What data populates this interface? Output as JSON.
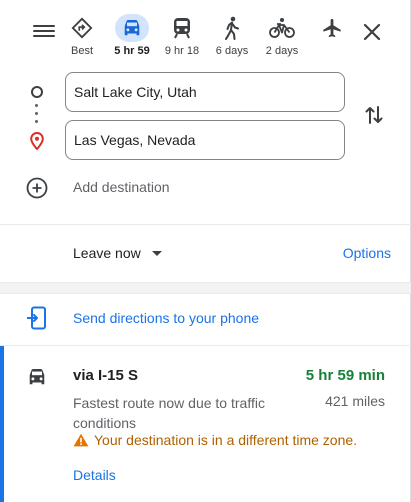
{
  "header": {
    "menu_icon": "hamburger-menu-icon",
    "close_icon": "close-icon",
    "modes": [
      {
        "icon": "best-route-diamond-icon",
        "label": "Best"
      },
      {
        "icon": "car-icon",
        "label": "5 hr 59"
      },
      {
        "icon": "transit-train-icon",
        "label": "9 hr 18"
      },
      {
        "icon": "walking-person-icon",
        "label": "6 days"
      },
      {
        "icon": "bicycle-icon",
        "label": "2 days"
      },
      {
        "icon": "airplane-icon",
        "label": ""
      }
    ]
  },
  "waypoints": {
    "origin": "Salt Lake City, Utah",
    "destination": "Las Vegas, Nevada",
    "add_label": "Add destination",
    "swap_icon": "swap-vertical-icon"
  },
  "departure": {
    "label": "Leave now",
    "options_label": "Options"
  },
  "send": {
    "label": "Send directions to your phone",
    "icon": "send-to-phone-icon"
  },
  "route": {
    "via": "via I-15 S",
    "duration": "5 hr 59 min",
    "description": "Fastest route now due to traffic conditions",
    "distance": "421 miles",
    "warning": "Your destination is in a different time zone.",
    "details_label": "Details"
  },
  "colors": {
    "accent_blue": "#1a73e8",
    "active_chip": "#d2e3fc",
    "duration_green": "#188038",
    "warning_orange": "#b06000",
    "pin_red": "#d93025"
  }
}
